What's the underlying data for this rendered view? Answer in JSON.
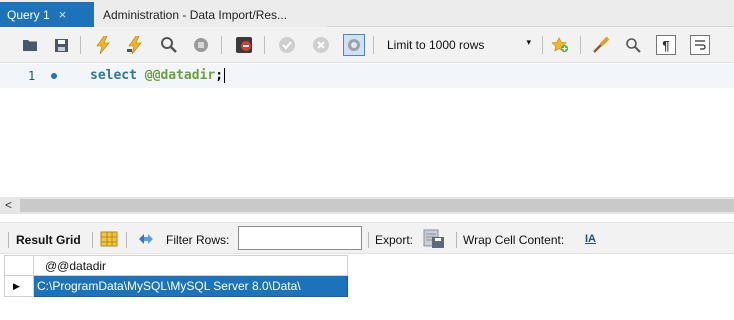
{
  "tabs": [
    {
      "label": "Query 1",
      "close": "×"
    },
    {
      "label": "Administration - Data Import/Res..."
    }
  ],
  "toolbar": {
    "limit_label": "Limit to 1000 rows",
    "caret": "▾"
  },
  "editor": {
    "line_number": "1",
    "code_keyword": "select",
    "code_variable": "@@datadir",
    "code_terminator": ";"
  },
  "scroll": {
    "left_arrow": "<"
  },
  "result_toolbar": {
    "result_grid_label": "Result Grid",
    "filter_rows_label": "Filter Rows:",
    "filter_value": "",
    "export_label": "Export:",
    "wrap_label": "Wrap Cell Content:",
    "wrap_icon_text": "IA"
  },
  "grid": {
    "columns": [
      "@@datadir"
    ],
    "rows": [
      [
        "C:\\ProgramData\\MySQL\\MySQL Server 8.0\\Data\\"
      ]
    ],
    "row_marker": "▶"
  },
  "colors": {
    "accent": "#1c73b9",
    "keyword": "#2a7a98",
    "variable": "#6aa23a"
  }
}
